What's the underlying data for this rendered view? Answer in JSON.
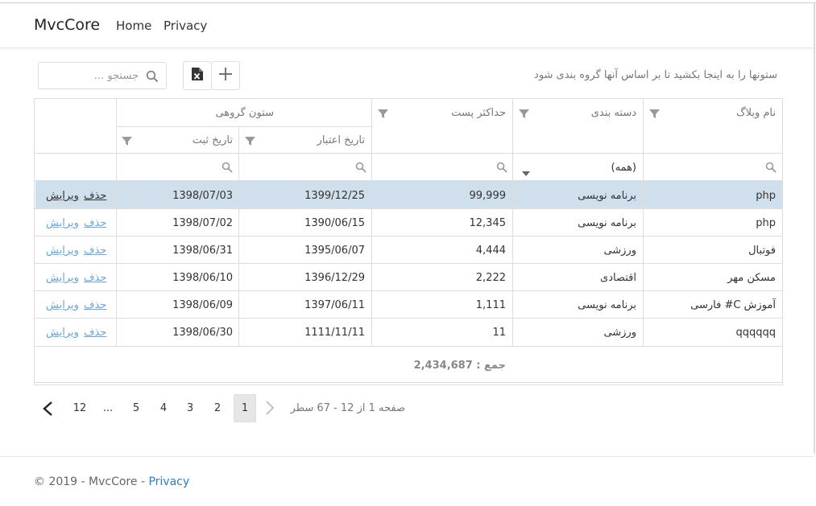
{
  "navbar": {
    "brand": "MvcCore",
    "links": [
      "Home",
      "Privacy"
    ]
  },
  "toolbar": {
    "group_panel_text": "ستونها را به اینجا بکشید تا بر اساس آنها گروه بندی شود",
    "search_placeholder": "جستجو ...",
    "add_icon": "plus-icon",
    "export_icon": "excel-export-icon"
  },
  "grid": {
    "headers": {
      "blog_name": "نام وبلاگ",
      "category": "دسته بندی",
      "max_posts": "حداکثر پست",
      "group": "ستون گروهی",
      "expiry_date": "تاریخ اعتبار",
      "register_date": "تاریخ ثبت"
    },
    "category_filter": "(همه)",
    "rows": [
      {
        "name": "php",
        "category": "برنامه نویسی",
        "max": "99,999",
        "expiry": "1399/12/25",
        "registered": "1398/07/03",
        "edit": "ویرایش",
        "delete": "حذف"
      },
      {
        "name": "php",
        "category": "برنامه نویسی",
        "max": "12,345",
        "expiry": "1390/06/15",
        "registered": "1398/07/02",
        "edit": "ویرایش",
        "delete": "حذف"
      },
      {
        "name": "فوتبال",
        "category": "ورزشی",
        "max": "4,444",
        "expiry": "1395/06/07",
        "registered": "1398/06/31",
        "edit": "ویرایش",
        "delete": "حذف"
      },
      {
        "name": "مسکن مهر",
        "category": "اقتصادی",
        "max": "2,222",
        "expiry": "1396/12/29",
        "registered": "1398/06/10",
        "edit": "ویرایش",
        "delete": "حذف"
      },
      {
        "name": "آموزش C# فارسی",
        "category": "برنامه نویسی",
        "max": "1,111",
        "expiry": "1397/06/11",
        "registered": "1398/06/09",
        "edit": "ویرایش",
        "delete": "حذف"
      },
      {
        "name": "qqqqqq",
        "category": "ورزشی",
        "max": "11",
        "expiry": "1111/11/11",
        "registered": "1398/06/30",
        "edit": "ویرایش",
        "delete": "حذف"
      }
    ],
    "selected_row": 0,
    "summary": "جمع : 2,434,687"
  },
  "pager": {
    "info": "صفحه 1 از 12 - 67 سطر",
    "pages": [
      "1",
      "2",
      "3",
      "4",
      "5",
      "...",
      "12"
    ],
    "current": "1"
  },
  "footer": {
    "text": "© 2019 - MvcCore - ",
    "link": "Privacy"
  },
  "colors": {
    "selected_row": "#d0dfec",
    "link": "#6aa5d3",
    "footer_link": "#337ab7"
  }
}
